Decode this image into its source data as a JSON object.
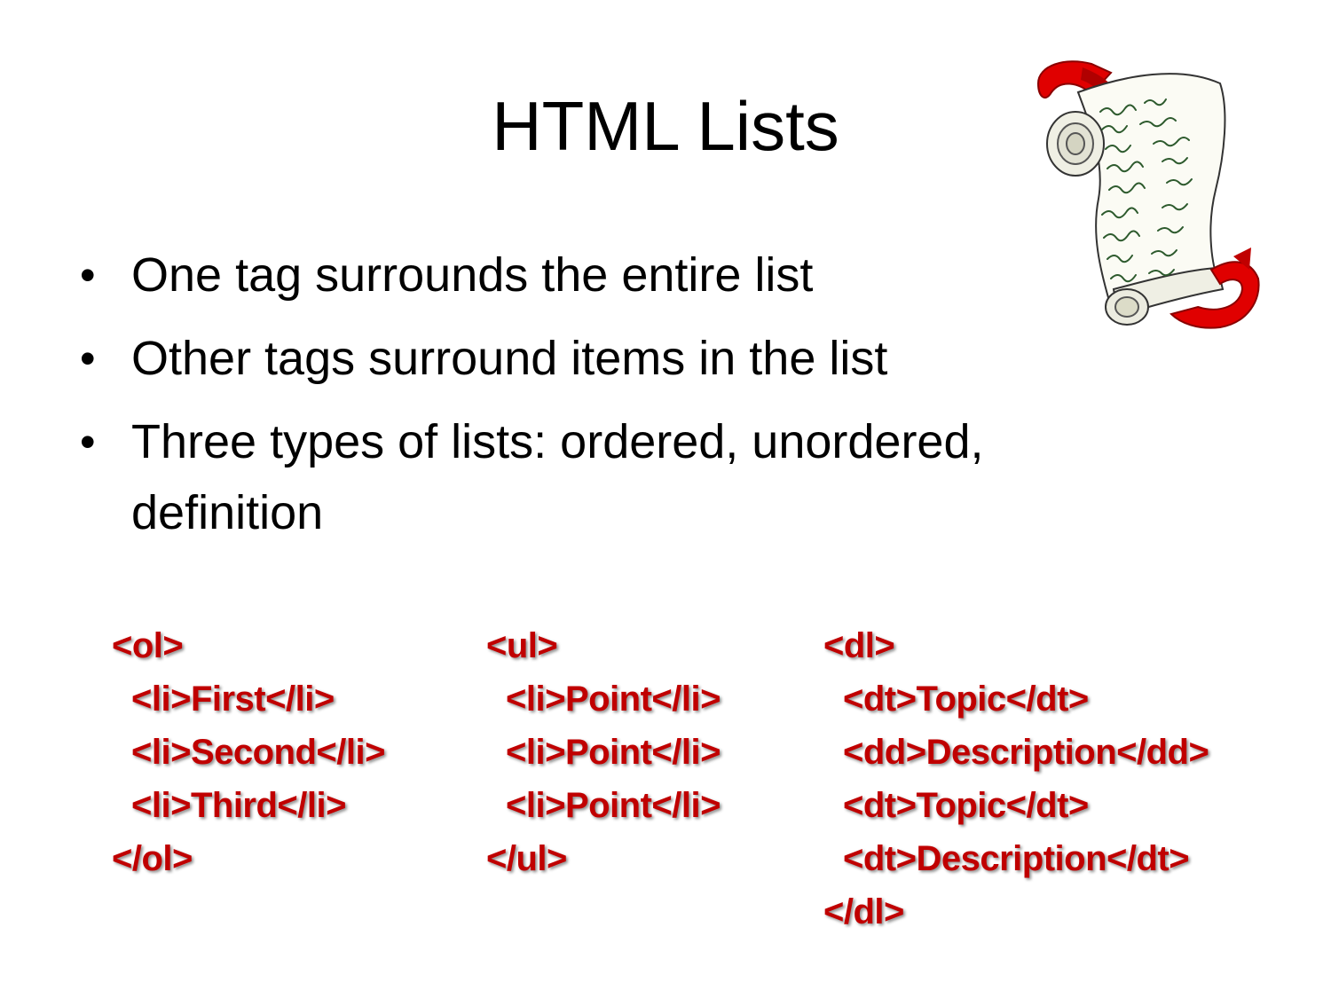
{
  "slide": {
    "title": "HTML Lists",
    "bullet_symbol": "•",
    "bullets": [
      "One tag surrounds the entire list",
      "Other tags surround items in the list",
      "Three types of lists:  ordered, unordered, definition"
    ]
  },
  "code_examples": {
    "ordered": {
      "open": "<ol>",
      "items": [
        "<li>First</li>",
        "<li>Second</li>",
        "<li>Third</li>"
      ],
      "close": "</ol>"
    },
    "unordered": {
      "open": "<ul>",
      "items": [
        "<li>Point</li>",
        "<li>Point</li>",
        "<li>Point</li>"
      ],
      "close": "</ul>"
    },
    "definition": {
      "open": "<dl>",
      "items": [
        "<dt>Topic</dt>",
        "<dd>Description</dd>",
        "<dt>Topic</dt>",
        "<dt>Description</dt>"
      ],
      "close": "</dl>"
    }
  },
  "colors": {
    "code_text": "#c00000",
    "ribbon": "#e00000"
  },
  "image": {
    "icon": "scroll-icon"
  }
}
